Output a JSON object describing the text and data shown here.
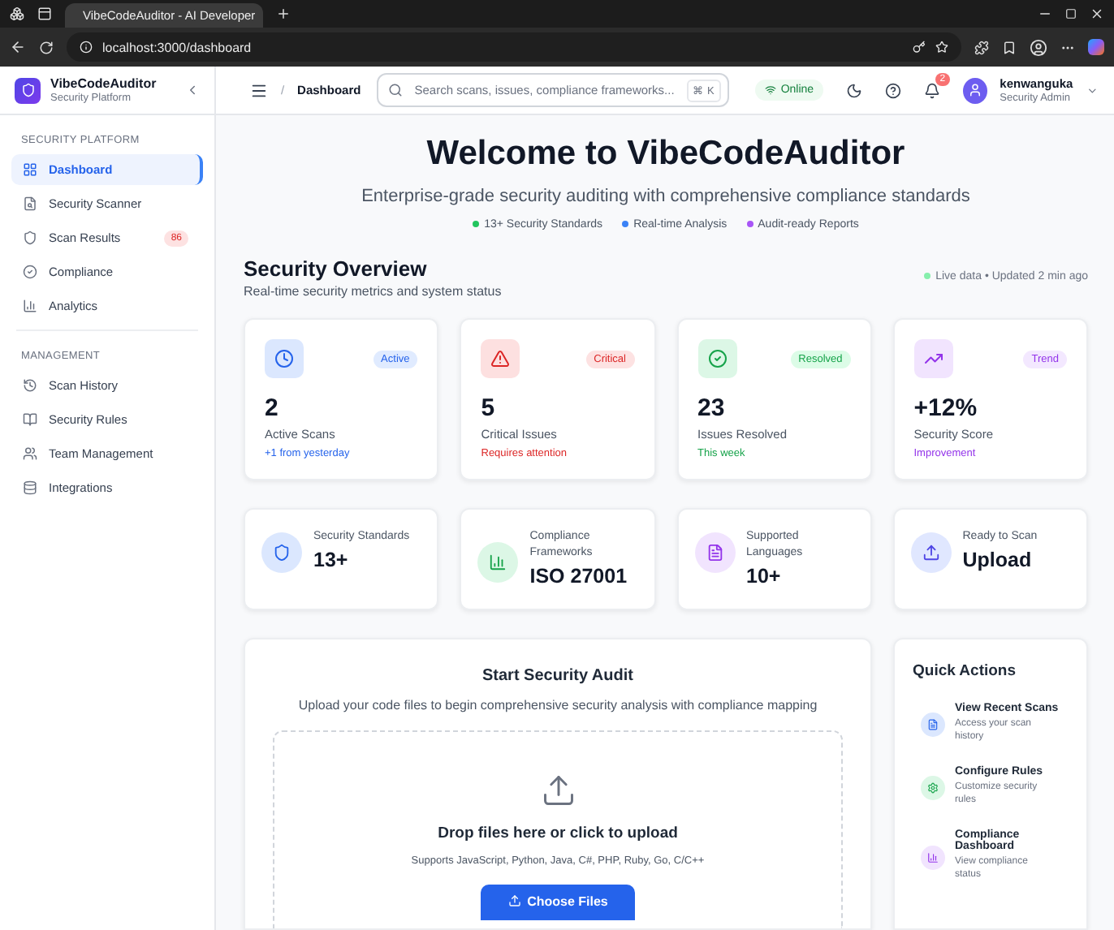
{
  "browser": {
    "tab_title": "VibeCodeAuditor - AI Developer",
    "address": "localhost:3000/dashboard"
  },
  "sidebar": {
    "brand": "VibeCodeAuditor",
    "brand_subtitle": "Security Platform",
    "sections": [
      {
        "heading": "SECURITY PLATFORM",
        "items": [
          {
            "label": "Dashboard",
            "selected": true
          },
          {
            "label": "Security Scanner",
            "selected": false
          },
          {
            "label": "Scan Results",
            "selected": false,
            "badge": "86"
          },
          {
            "label": "Compliance",
            "selected": false
          },
          {
            "label": "Analytics",
            "selected": false
          }
        ]
      },
      {
        "heading": "MANAGEMENT",
        "items": [
          {
            "label": "Scan History",
            "selected": false
          },
          {
            "label": "Security Rules",
            "selected": false
          },
          {
            "label": "Team Management",
            "selected": false
          },
          {
            "label": "Integrations",
            "selected": false
          }
        ]
      }
    ]
  },
  "header": {
    "breadcrumb_separator": "/",
    "breadcrumb": "Dashboard",
    "search_placeholder": "Search scans, issues, compliance frameworks...",
    "shortcut": "⌘ K",
    "status": "Online",
    "notifications": "2",
    "user_name": "kenwanguka",
    "user_role": "Security Admin"
  },
  "hero": {
    "title": "Welcome to VibeCodeAuditor",
    "subtitle": "Enterprise-grade security auditing with comprehensive compliance standards",
    "features": [
      {
        "label": "13+ Security Standards",
        "color": "#22c55e"
      },
      {
        "label": "Real-time Analysis",
        "color": "#3b82f6"
      },
      {
        "label": "Audit-ready Reports",
        "color": "#a855f7"
      }
    ]
  },
  "overview": {
    "title": "Security Overview",
    "subtitle": "Real-time security metrics and system status",
    "live": "Live data • Updated 2 min ago"
  },
  "stat_cards": [
    {
      "kind": "blue",
      "badge": "Active",
      "value": "2",
      "label": "Active Scans",
      "note": "+1 from yesterday"
    },
    {
      "kind": "red",
      "badge": "Critical",
      "value": "5",
      "label": "Critical Issues",
      "note": "Requires attention"
    },
    {
      "kind": "green",
      "badge": "Resolved",
      "value": "23",
      "label": "Issues Resolved",
      "note": "This week"
    },
    {
      "kind": "purple",
      "badge": "Trend",
      "value": "+12%",
      "label": "Security Score",
      "note": "Improvement"
    }
  ],
  "info_cards": [
    {
      "kind": "blue",
      "label": "Security Standards",
      "value": "13+"
    },
    {
      "kind": "green",
      "label": "Compliance Frameworks",
      "value": "ISO 27001"
    },
    {
      "kind": "purple",
      "label": "Supported Languages",
      "value": "10+"
    },
    {
      "kind": "indigo",
      "label": "Ready to Scan",
      "value": "Upload"
    }
  ],
  "audit": {
    "title": "Start Security Audit",
    "subtitle": "Upload your code files to begin comprehensive security analysis with compliance mapping",
    "drop_title": "Drop files here or click to upload",
    "drop_hint": "Supports JavaScript, Python, Java, C#, PHP, Ruby, Go, C/C++",
    "button": "Choose Files"
  },
  "quick_actions": {
    "title": "Quick Actions",
    "items": [
      {
        "kind": "blue",
        "title": "View Recent Scans",
        "description": "Access your scan history"
      },
      {
        "kind": "green",
        "title": "Configure Rules",
        "description": "Customize security rules"
      },
      {
        "kind": "purple",
        "title": "Compliance Dashboard",
        "description": "View compliance status"
      }
    ]
  }
}
